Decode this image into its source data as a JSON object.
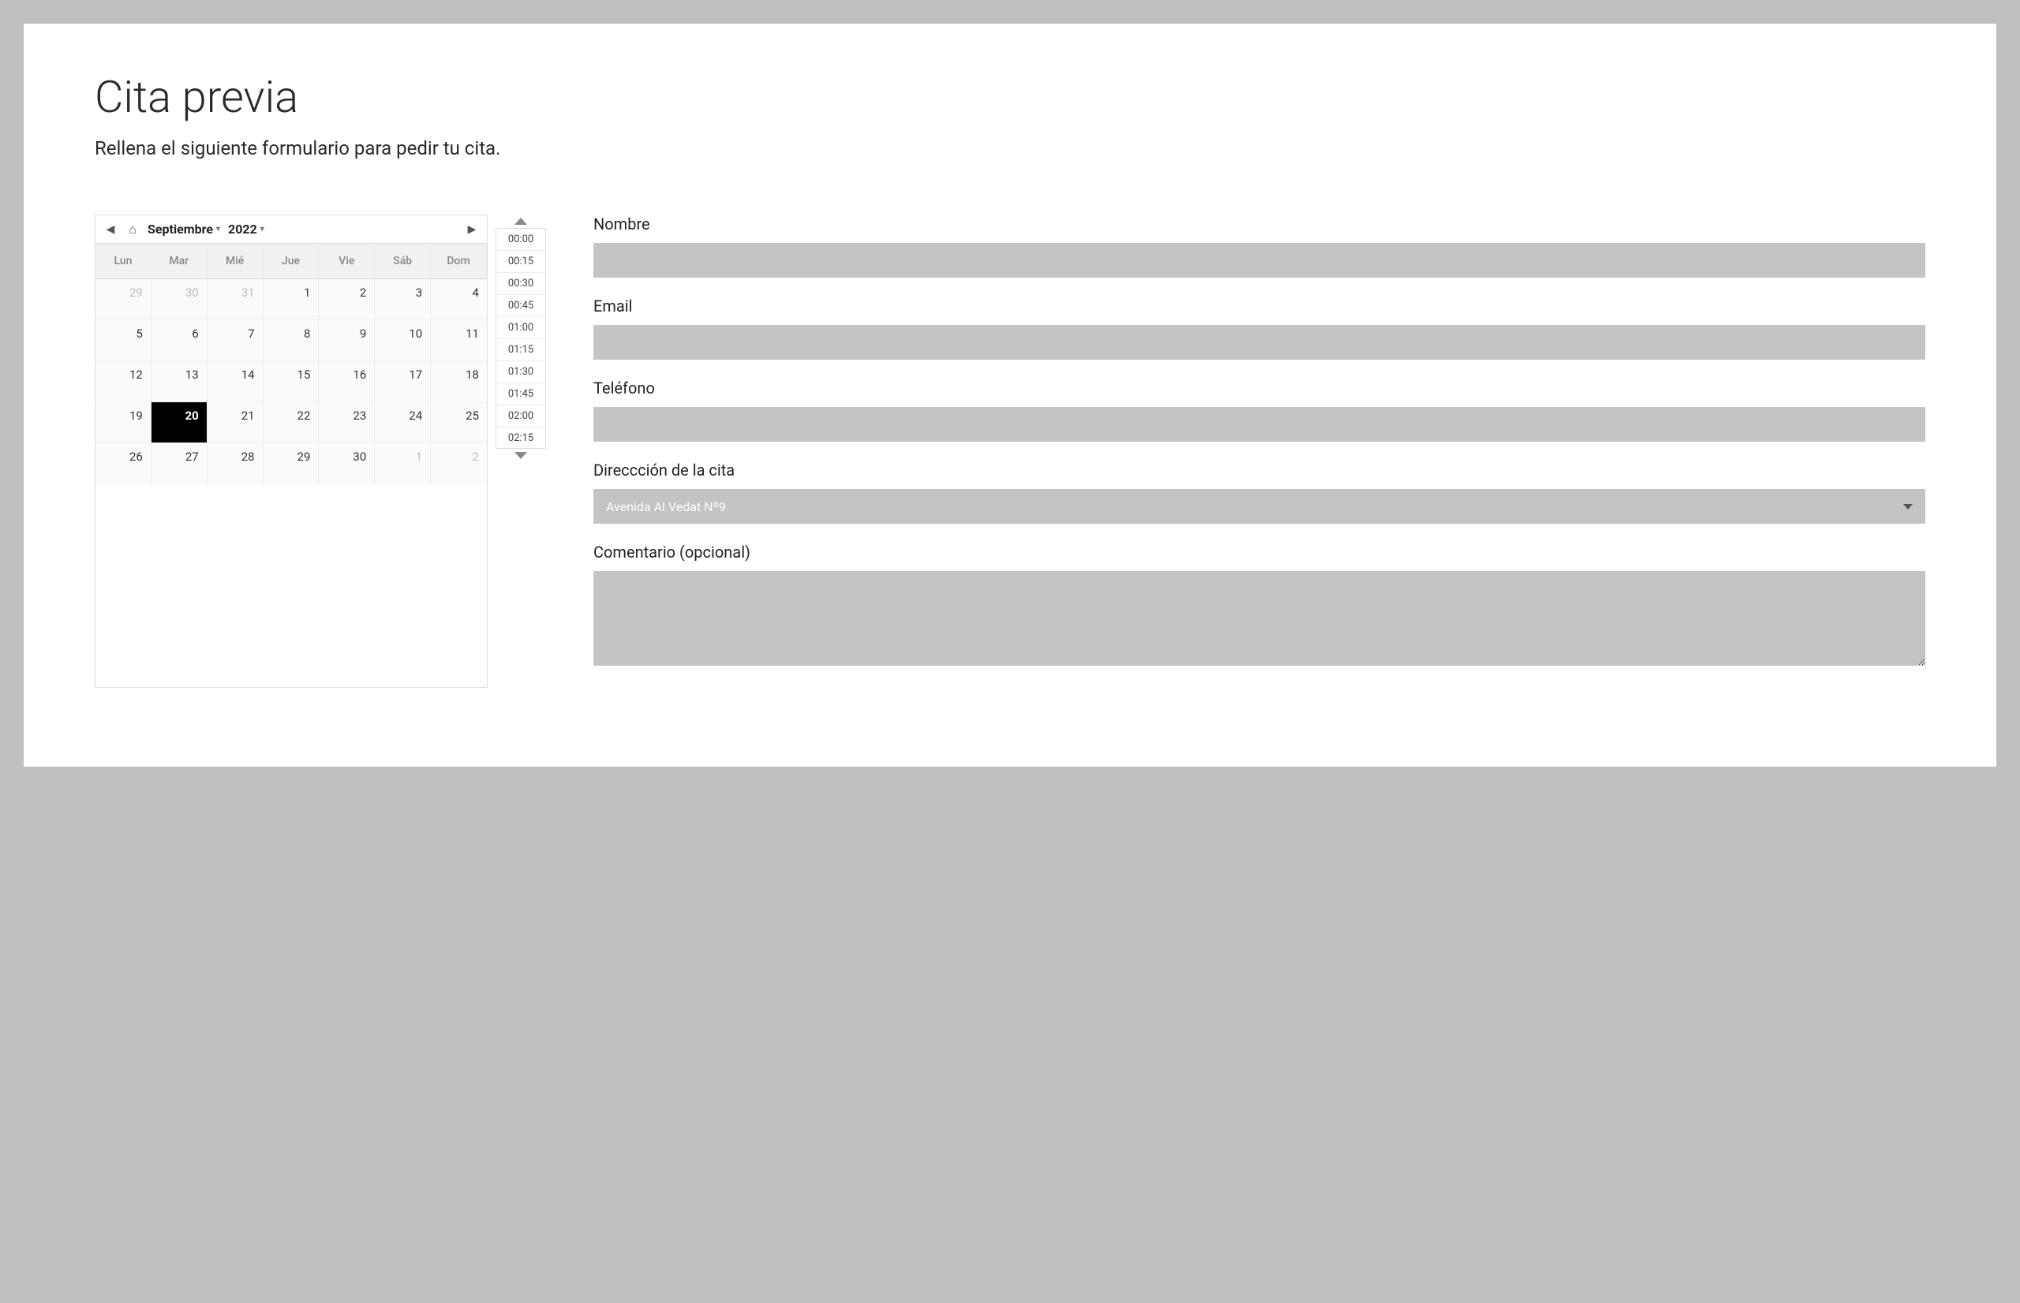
{
  "header": {
    "title": "Cita previa",
    "subtitle": "Rellena el siguiente formulario para pedir tu cita."
  },
  "calendar": {
    "month": "Septiembre",
    "year": "2022",
    "dow": [
      "Lun",
      "Mar",
      "Mié",
      "Jue",
      "Vie",
      "Sáb",
      "Dom"
    ],
    "weeks": [
      [
        {
          "d": "29",
          "o": true
        },
        {
          "d": "30",
          "o": true
        },
        {
          "d": "31",
          "o": true
        },
        {
          "d": "1"
        },
        {
          "d": "2"
        },
        {
          "d": "3"
        },
        {
          "d": "4"
        }
      ],
      [
        {
          "d": "5"
        },
        {
          "d": "6"
        },
        {
          "d": "7"
        },
        {
          "d": "8"
        },
        {
          "d": "9"
        },
        {
          "d": "10"
        },
        {
          "d": "11"
        }
      ],
      [
        {
          "d": "12"
        },
        {
          "d": "13"
        },
        {
          "d": "14"
        },
        {
          "d": "15"
        },
        {
          "d": "16"
        },
        {
          "d": "17"
        },
        {
          "d": "18"
        }
      ],
      [
        {
          "d": "19"
        },
        {
          "d": "20",
          "sel": true
        },
        {
          "d": "21"
        },
        {
          "d": "22"
        },
        {
          "d": "23"
        },
        {
          "d": "24"
        },
        {
          "d": "25"
        }
      ],
      [
        {
          "d": "26"
        },
        {
          "d": "27"
        },
        {
          "d": "28"
        },
        {
          "d": "29"
        },
        {
          "d": "30"
        },
        {
          "d": "1",
          "o": true
        },
        {
          "d": "2",
          "o": true
        }
      ]
    ]
  },
  "times": [
    "00:00",
    "00:15",
    "00:30",
    "00:45",
    "01:00",
    "01:15",
    "01:30",
    "01:45",
    "02:00",
    "02:15"
  ],
  "form": {
    "name_label": "Nombre",
    "email_label": "Email",
    "phone_label": "Teléfono",
    "address_label": "Direccción de la cita",
    "address_value": "Avenida Al Vedat Nº9",
    "comment_label": "Comentario (opcional)"
  }
}
